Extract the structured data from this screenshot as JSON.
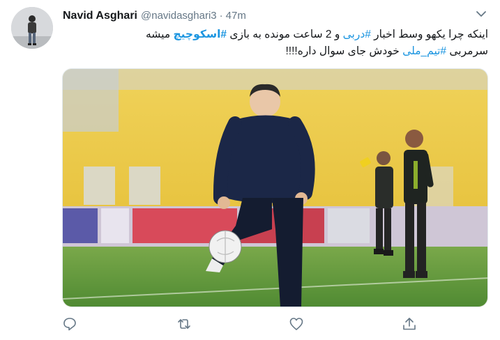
{
  "tweet": {
    "author_name": "Navid Asghari",
    "author_handle": "@navidasghari3",
    "separator": "·",
    "time": "47m",
    "text": {
      "line1_a": "اینکه چرا یکهو وسط اخبار ",
      "line1_tag1": "#دربی",
      "line1_b": " و 2 ساعت مونده به بازی ",
      "line1_tag2": "#اسکوچیچ",
      "line1_c": " میشه",
      "line2_a": "سرمربی ",
      "line2_tag": "#تیم_ملی",
      "line2_b": " خودش جای سوال داره!!!!"
    }
  },
  "icons": {
    "caret": "chevron-down-icon",
    "reply": "reply-icon",
    "retweet": "retweet-icon",
    "like": "heart-icon",
    "share": "share-icon"
  },
  "colors": {
    "link": "#1b95e0",
    "secondary": "#657786",
    "stadium": "#e8c43a",
    "grass": "#5f9a3c"
  }
}
